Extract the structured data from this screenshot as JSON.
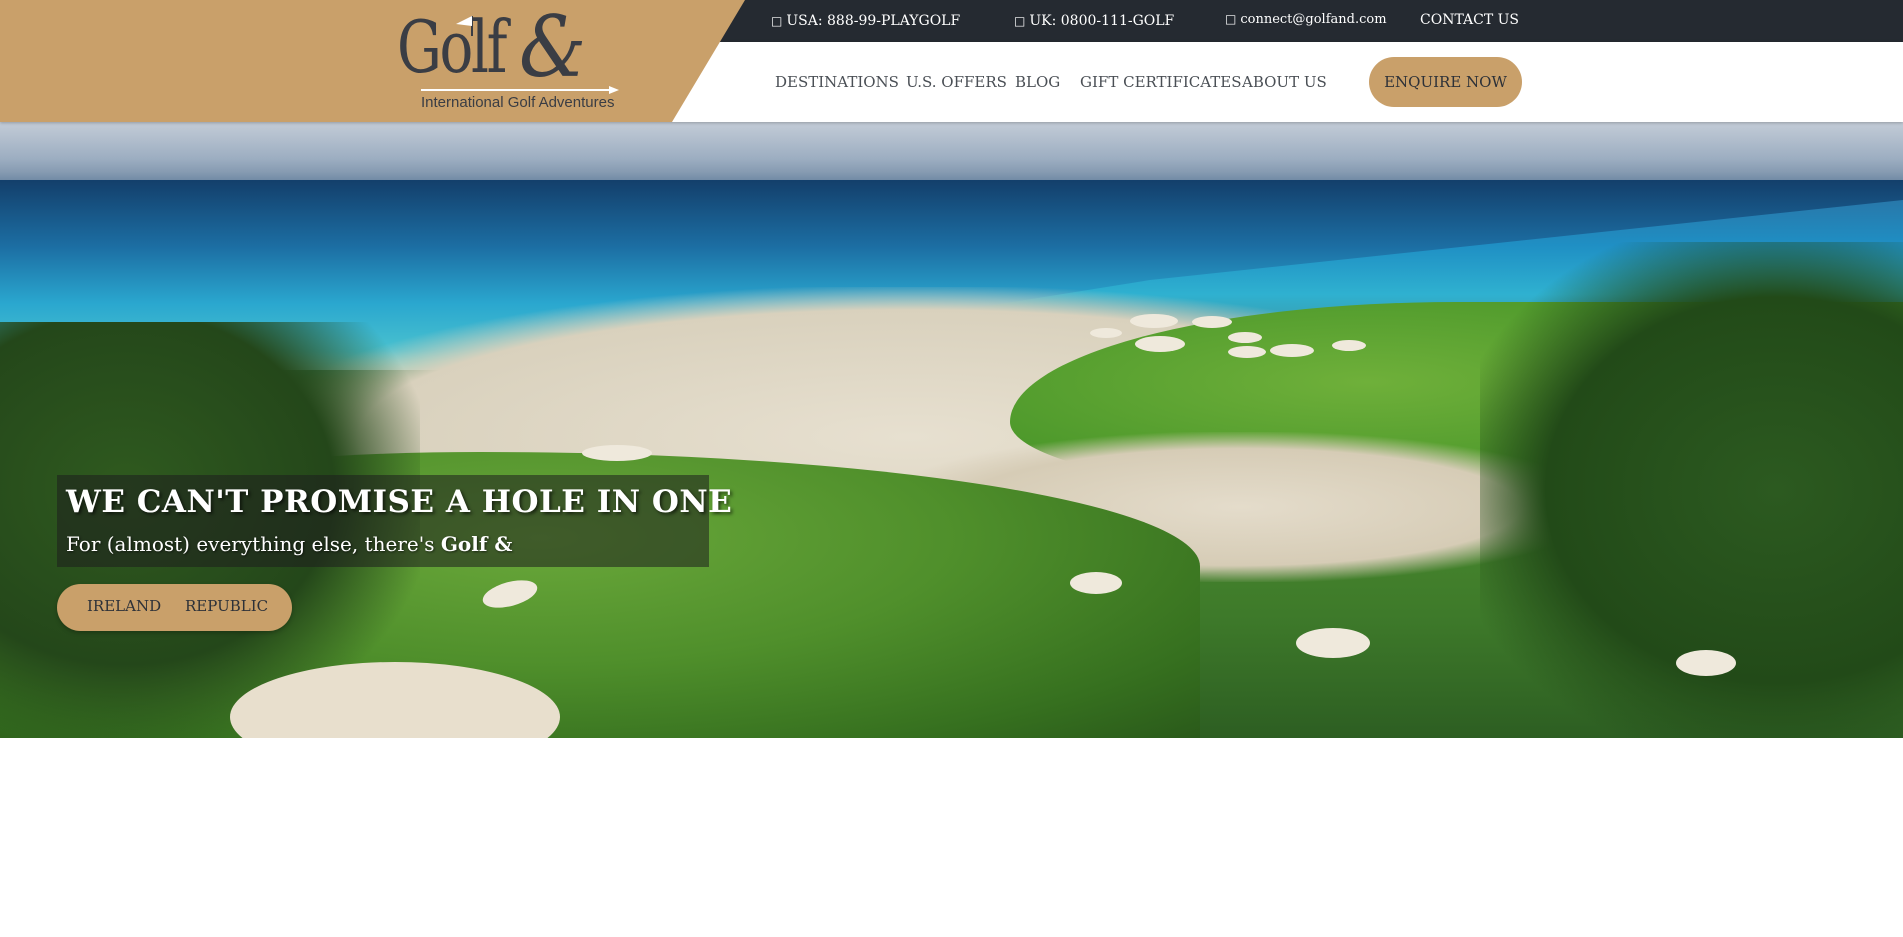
{
  "colors": {
    "brand_gold": "#c9a06a",
    "topbar_bg": "#252a31",
    "nav_text": "#4a4f55",
    "logo_text": "#3a3d44"
  },
  "logo": {
    "wordmark": "Golf",
    "ampersand": "&",
    "tagline": "International Golf Adventures"
  },
  "topbar": {
    "usa_phone": "USA: 888-99-PLAYGOLF",
    "uk_phone": "UK: 0800-111-GOLF",
    "email": "connect@golfand.com",
    "contact": "CONTACT US",
    "phone_icon": "□",
    "email_icon": "□"
  },
  "nav": {
    "items": [
      {
        "label": "DESTINATIONS"
      },
      {
        "label": "U.S. OFFERS"
      },
      {
        "label": "BLOG"
      },
      {
        "label": "GIFT CERTIFICATES"
      },
      {
        "label": "ABOUT US"
      }
    ],
    "cta": "ENQUIRE NOW"
  },
  "hero": {
    "headline": "WE CAN'T PROMISE A HOLE IN ONE",
    "subline_prefix": "For (almost) everything else, there's ",
    "subline_brand": "Golf &",
    "pills": [
      "IRELAND",
      "REPUBLIC"
    ]
  }
}
